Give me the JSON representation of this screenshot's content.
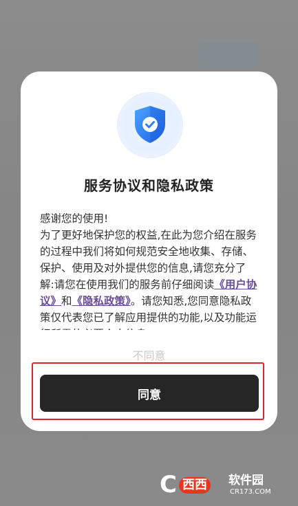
{
  "dialog": {
    "title": "服务协议和隐私政策",
    "intro_line": "感谢您的使用!",
    "body_start": "为了更好地保护您的权益,在此为您介绍在服务的过程中我们将如何规范安全地收集、存储、保护、使用及对外提供您的信息,请您充分了解:请您在使用我们的服务前仔细阅读",
    "user_agreement_link": "《用户协议》",
    "and_text": "和",
    "privacy_link": "《隐私政策》",
    "body_end": "。请您知悉,您同意隐私政策仅代表您已了解应用提供的功能,以及功能运行所需的必要个人信息",
    "disagree_label": "不同意",
    "agree_label": "同意"
  },
  "colors": {
    "accent_link": "#6a4c93",
    "agree_button_bg": "#262626",
    "shield_blue": "#2f80ed",
    "highlight_border": "#d9262c"
  },
  "icons": {
    "shield": "shield-check-icon"
  },
  "watermark": {
    "brand": "西西",
    "name": "软件园",
    "url": "CR173.COM"
  }
}
